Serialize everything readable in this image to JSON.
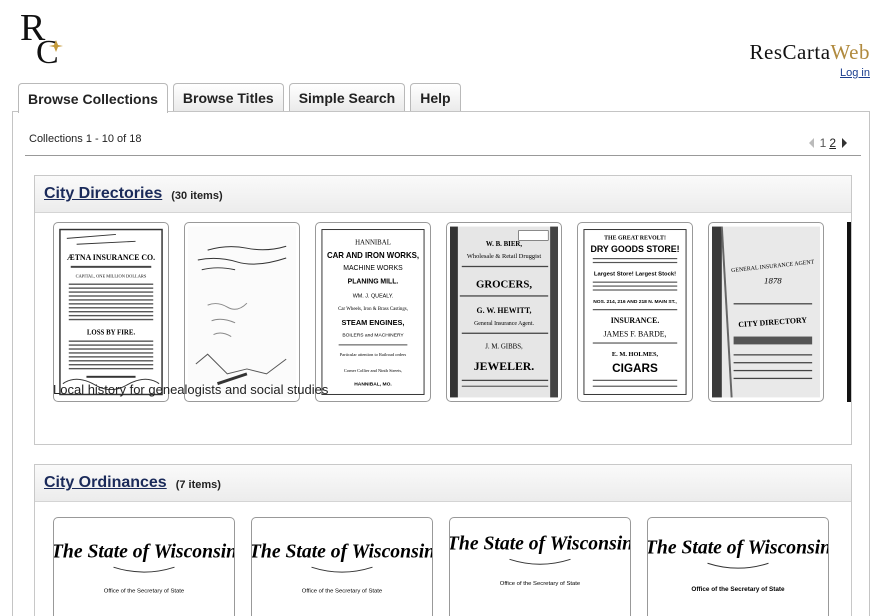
{
  "brand": {
    "name_main": "ResCarta",
    "name_web": "Web",
    "logo_letters": "RC",
    "login_label": "Log in"
  },
  "tabs": [
    {
      "label": "Browse Collections",
      "active": true
    },
    {
      "label": "Browse Titles",
      "active": false
    },
    {
      "label": "Simple Search",
      "active": false
    },
    {
      "label": "Help",
      "active": false
    }
  ],
  "results": {
    "count_text": "Collections 1 - 10 of 18"
  },
  "pager": {
    "current": "1",
    "next": "2"
  },
  "collections": [
    {
      "title": "City Directories",
      "count": "(30 items)",
      "description": "Local history for genealogists and social studies",
      "thumbnails": [
        {
          "lines": [
            "ÆTNA INSURANCE CO.",
            "CAPITAL, ONE MILLION DOLLARS",
            "LOSS BY FIRE."
          ]
        },
        {
          "lines": [
            "handwritten page"
          ]
        },
        {
          "lines": [
            "HANNIBAL",
            "CAR AND IRON WORKS,",
            "MACHINE WORKS",
            "PLANING MILL.",
            "WM. J. QUEALY.",
            "Car Wheels, Iron & Brass Castings,",
            "STEAM ENGINES,",
            "BOILERS and MACHINERY",
            "Particular attention to Railroad orders",
            "Corner Collier and Ninth Streets,",
            "HANNIBAL, MO."
          ]
        },
        {
          "lines": [
            "W. B. BIER,",
            "Wholesale & Retail Druggist",
            "GROCERS,",
            "G. W. HEWITT,",
            "General Insurance Agent.",
            "J. M. GIBBS,",
            "JEWELER."
          ]
        },
        {
          "lines": [
            "THE GREAT REVOLT!",
            "DRY GOODS STORE!",
            "Largest Store! Largest Stock!",
            "NOS. 214, 216 AND 218 N. MAIN ST.,",
            "INSURANCE.",
            "JAMES F. BARDE,",
            "E. M. HOLMES,",
            "CIGARS"
          ]
        },
        {
          "lines": [
            "GENERAL INSURANCE AGENT",
            "1878",
            "CITY DIRECTORY"
          ]
        }
      ]
    },
    {
      "title": "City Ordinances",
      "count": "(7 items)",
      "thumbnails": [
        {
          "heading": "The State of Wisconsin",
          "sub": "Office of the Secretary of State"
        },
        {
          "heading": "The State of Wisconsin",
          "sub": "Office of the Secretary of State"
        },
        {
          "heading": "The State of Wisconsin",
          "sub": "Office of the Secretary of State"
        },
        {
          "heading": "The State of Wisconsin",
          "sub": "Office of the Secretary of State"
        }
      ]
    }
  ]
}
